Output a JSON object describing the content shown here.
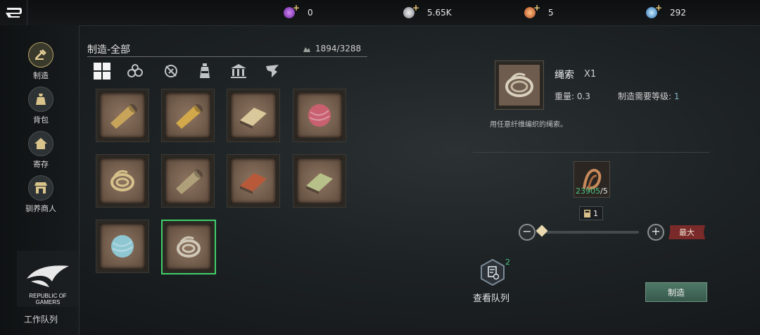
{
  "currencies": [
    {
      "name": "purple-orb-icon",
      "value": "0",
      "color": "#9b3fd6"
    },
    {
      "name": "silver-coin-icon",
      "value": "5.65K",
      "color": "#b9bdc2"
    },
    {
      "name": "copper-gem-icon",
      "value": "5",
      "color": "#e0703a"
    },
    {
      "name": "blue-crystal-icon",
      "value": "292",
      "color": "#4aa3e0"
    }
  ],
  "nav": [
    {
      "label": "制造",
      "icon": "hammer-icon",
      "active": true
    },
    {
      "label": "背包",
      "icon": "bag-icon",
      "active": false
    },
    {
      "label": "寄存",
      "icon": "house-icon",
      "active": false
    },
    {
      "label": "驯养商人",
      "icon": "merchant-icon",
      "active": false
    }
  ],
  "craft": {
    "title": "制造-全部",
    "capacity": "1894/3288",
    "categories": [
      "grid-icon",
      "logs-icon",
      "tools-icon",
      "potion-icon",
      "building-icon",
      "beast-icon"
    ],
    "items": [
      {
        "name": "cloth-bolt",
        "color": "#c8a45a"
      },
      {
        "name": "silk-bolt",
        "color": "#d2a84a"
      },
      {
        "name": "canvas-fold",
        "color": "#d8c89a"
      },
      {
        "name": "red-yarn-ball",
        "color": "#c86070"
      },
      {
        "name": "rope-coil",
        "color": "#d6c08a"
      },
      {
        "name": "linen-roll",
        "color": "#b0a07a"
      },
      {
        "name": "leather-fold",
        "color": "#b85a3a"
      },
      {
        "name": "green-fabric",
        "color": "#b8c08a"
      },
      {
        "name": "blue-yarn-ball",
        "color": "#8ec6d2"
      },
      {
        "name": "rope-coil-selected",
        "color": "#cfc7b6",
        "selected": true
      }
    ]
  },
  "bottom": {
    "logo": "REPUBLIC OF GAMERS",
    "queue_label": "工作队列"
  },
  "detail": {
    "name": "绳索",
    "qty": "X1",
    "weight": "重量: 0.3",
    "level_label": "制造需要等级:",
    "level_value": "1",
    "description": "用任意纤维编织的绳索。",
    "material_have": "23905",
    "material_need": "/5",
    "amount": "1",
    "max_label": "最大",
    "queue_badge": "2",
    "queue_label": "查看队列",
    "craft_label": "制造"
  }
}
